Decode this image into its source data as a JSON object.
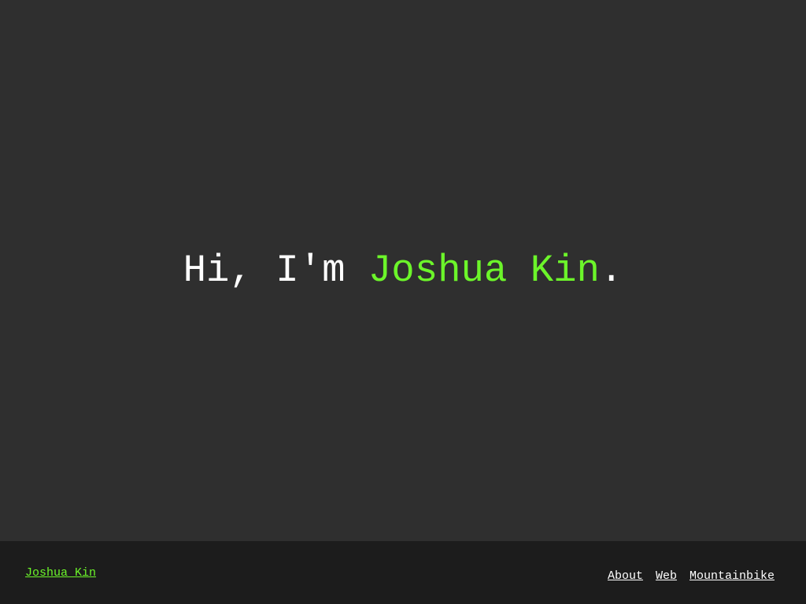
{
  "hero": {
    "greeting": "Hi, I'm ",
    "name": "Joshua Kin",
    "punctuation": "."
  },
  "footer": {
    "brand": "Joshua Kin",
    "nav": [
      {
        "label": "About"
      },
      {
        "label": "Web"
      },
      {
        "label": "Mountainbike"
      }
    ]
  },
  "colors": {
    "background": "#2f2f2f",
    "footer_background": "#1c1c1c",
    "accent": "#6cf52a",
    "text": "#ffffff"
  }
}
